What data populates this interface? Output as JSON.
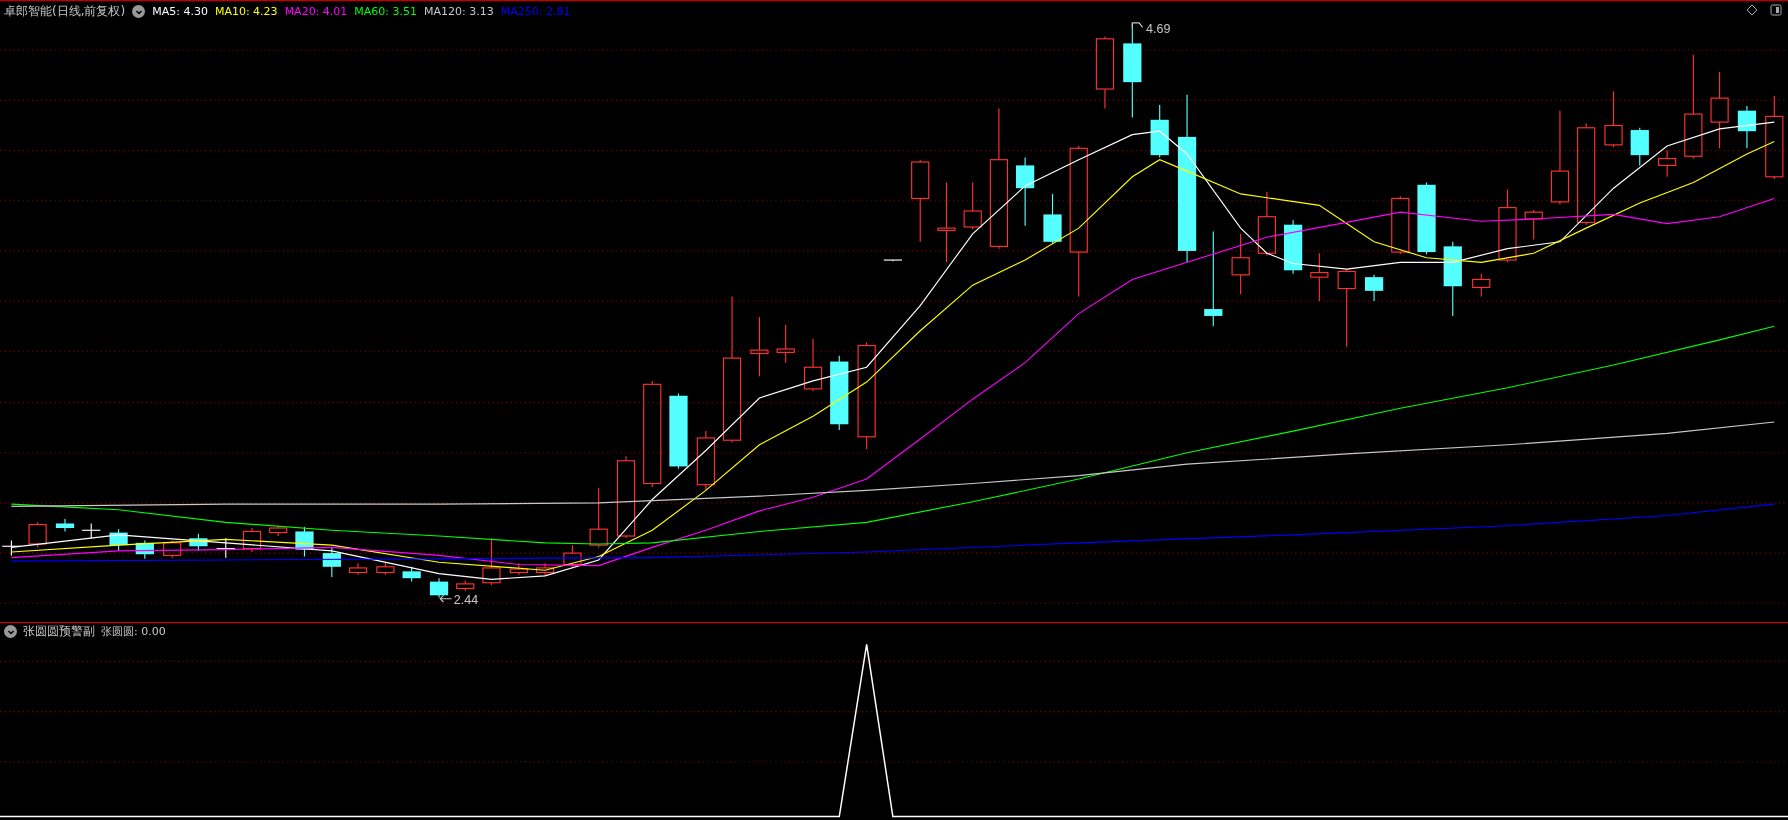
{
  "main_panel": {
    "title": "卓郎智能(日线,前复权)",
    "moving_averages": [
      {
        "label": "MA5: 4.30",
        "color": "#ffffff"
      },
      {
        "label": "MA10: 4.23",
        "color": "#ffff00"
      },
      {
        "label": "MA20: 4.01",
        "color": "#ff00ff"
      },
      {
        "label": "MA60: 3.51",
        "color": "#00ff00"
      },
      {
        "label": "MA120: 3.13",
        "color": "#c8c8c8"
      },
      {
        "label": "MA250: 2.81",
        "color": "#0000ff"
      }
    ],
    "high_label": "4.69",
    "low_label": "2.44"
  },
  "sub_panel": {
    "title": "张圆圆预警副",
    "value": "张圆圆: 0.00"
  }
}
